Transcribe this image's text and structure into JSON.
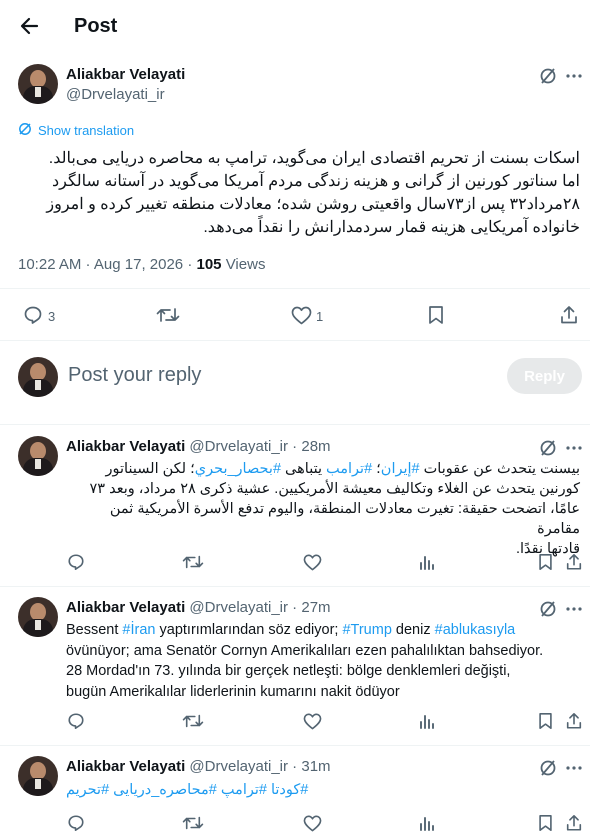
{
  "header": {
    "title": "Post"
  },
  "main_post": {
    "author": "Aliakbar Velayati",
    "handle": "@Drvelayati_ir",
    "show_translation": "Show translation",
    "lines": [
      "اسکات بسنت از تحریم اقتصادی ایران می‌گوید، ترامپ به محاصره دریایی می‌بالد.",
      "اما سناتور کورنین از گرانی و هزینه زندگی مردم آمریکا می‌گوید در آستانه سالگرد",
      "۲۸مرداد۳۲ پس از۷۳سال واقعیتی روشن شده؛ معادلات منطقه تغییر کرده و امروز",
      "خانواده آمریکایی هزینه قمار سردمدارانش را نقداً می‌دهد."
    ],
    "time": "10:22 AM",
    "date": "Aug 17, 2026",
    "views_count": "105",
    "views_label": "Views",
    "replies": "3",
    "likes": "1"
  },
  "reply_box": {
    "placeholder": "Post your reply",
    "button": "Reply"
  },
  "replies": [
    {
      "author": "Aliakbar Velayati",
      "handle": "@Drvelayati_ir",
      "age": "28m",
      "lines": [
        "بيسنت يتحدث عن عقوبات #إيران؛ #ترامب يتباهى #بحصار_بحري؛ لكن السيناتور",
        "كورنين يتحدث عن الغلاء وتكاليف معيشة الأمريكيين. عشية ذكرى ٢٨ مرداد، وبعد ٧٣",
        "عامًا، اتضحت حقيقة: تغيرت معادلات المنطقة، واليوم تدفع الأسرة الأمريكية ثمن مقامرة",
        "قادتها نقدًا."
      ]
    },
    {
      "author": "Aliakbar Velayati",
      "handle": "@Drvelayati_ir",
      "age": "27m",
      "lines": [
        "Bessent #İran yaptırımlarından söz ediyor; #Trump deniz #ablukasıyla",
        "övünüyor; ama Senatör Cornyn Amerikalıları ezen pahalılıktan bahsediyor.",
        "28 Mordad'ın 73. yılında bir gerçek netleşti: bölge denklemleri değişti,",
        "bugün Amerikalılar liderlerinin kumarını nakit ödüyor"
      ]
    },
    {
      "author": "Aliakbar Velayati",
      "handle": "@Drvelayati_ir",
      "age": "31m",
      "lines": [
        "#کودتا #ترامپ #محاصره_دریایی #تحریم"
      ]
    }
  ],
  "colors": {
    "link": "#1d9bf0",
    "muted": "#536471",
    "text": "#0f1419",
    "divider": "#eff3f4"
  },
  "icons": [
    "back-arrow-icon",
    "grok-icon",
    "more-icon",
    "translate-icon",
    "reply-icon",
    "repost-icon",
    "like-icon",
    "bookmark-icon",
    "share-icon",
    "analytics-icon"
  ]
}
